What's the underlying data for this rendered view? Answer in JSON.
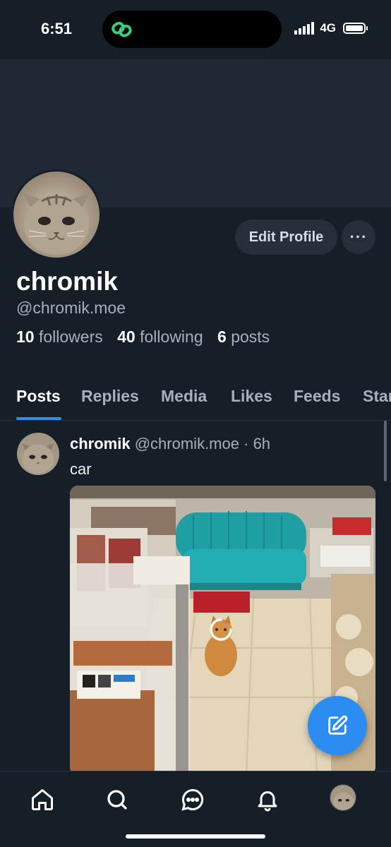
{
  "status_bar": {
    "time": "6:51",
    "network": "4G",
    "battery_icon": "battery-icon",
    "island_app_icon": "link-rings-icon"
  },
  "profile": {
    "display_name": "chromik",
    "handle": "@chromik.moe",
    "avatar_icon": "cat-avatar",
    "edit_button_label": "Edit Profile",
    "more_button_label": "···",
    "stats": [
      {
        "count": "10",
        "label": "followers"
      },
      {
        "count": "40",
        "label": "following"
      },
      {
        "count": "6",
        "label": "posts"
      }
    ]
  },
  "tabs": [
    {
      "label": "Posts",
      "active": true
    },
    {
      "label": "Replies",
      "active": false
    },
    {
      "label": "Media",
      "active": false
    },
    {
      "label": "Likes",
      "active": false
    },
    {
      "label": "Feeds",
      "active": false
    },
    {
      "label": "Starter Packs",
      "active": false
    }
  ],
  "post": {
    "author": "chromik",
    "handle": "@chromik.moe",
    "separator": "·",
    "time": "6h",
    "text": "car",
    "image_icon": "shop-with-cat-photo"
  },
  "fab_icon": "compose-icon",
  "bottom_nav": [
    {
      "icon": "home-icon"
    },
    {
      "icon": "search-icon"
    },
    {
      "icon": "chat-icon"
    },
    {
      "icon": "bell-icon"
    },
    {
      "icon": "profile-avatar"
    }
  ],
  "colors": {
    "background": "#161e27",
    "banner": "#1e2935",
    "accent": "#2b8cf2",
    "muted_text": "#a5b0bd"
  }
}
